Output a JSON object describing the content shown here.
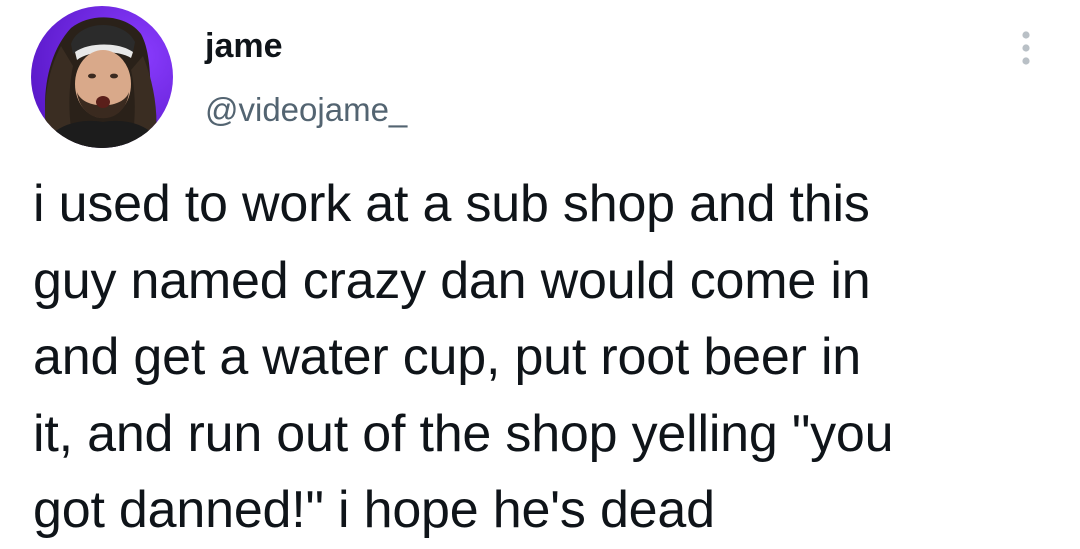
{
  "author": {
    "display_name": "jame",
    "handle": "@videojame_",
    "avatar_icon": "user-avatar-photo"
  },
  "more_icon": "more-vertical-icon",
  "tweet": {
    "lines": [
      "i used to work at a sub shop and this",
      "guy named crazy dan would come in",
      "and get a water cup, put root beer in",
      "it, and run out of the shop yelling \"you",
      "got danned!\" i hope he's dead"
    ]
  },
  "colors": {
    "text": "#0f1419",
    "secondary_text": "#536471",
    "avatar_background": "#7b2ff7",
    "more_icon": "#b9c0c6"
  }
}
